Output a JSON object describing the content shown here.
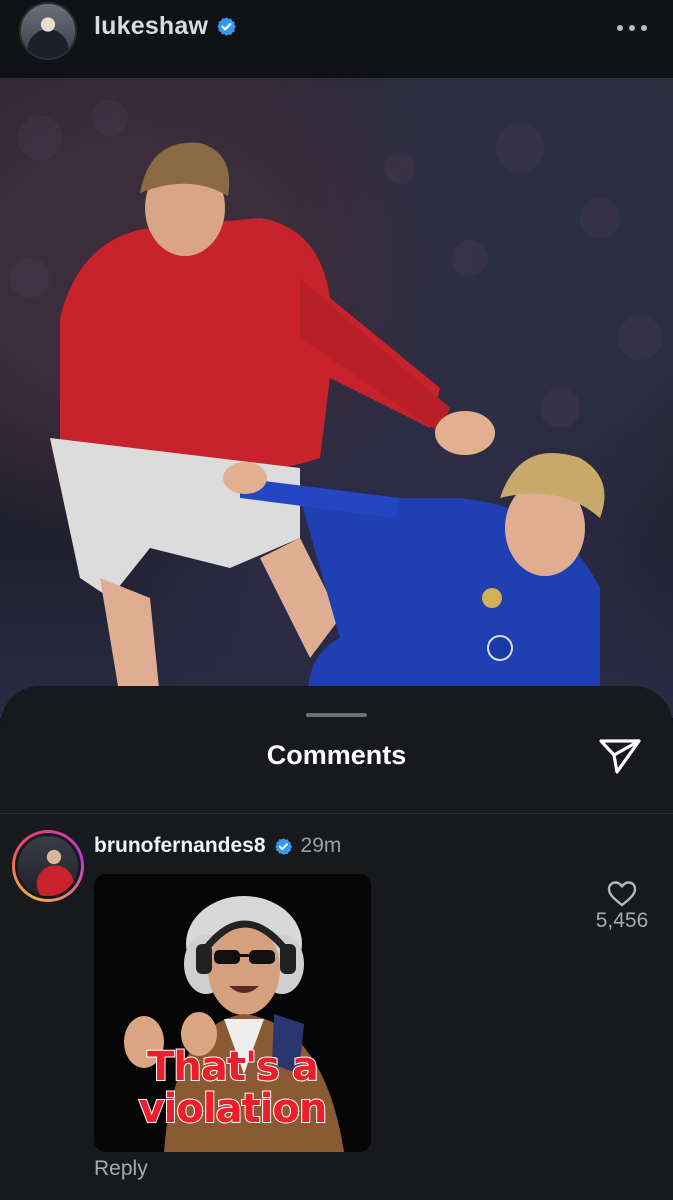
{
  "header": {
    "username": "lukeshaw",
    "verified_icon": "verified-badge-icon",
    "more_icon": "more-horizontal-icon"
  },
  "post": {
    "image_description_icon": "post-photo"
  },
  "comments_sheet": {
    "title": "Comments",
    "share_icon": "send-icon"
  },
  "comment": {
    "username": "brunofernandes8",
    "time": "29m",
    "gif_caption_line1": "That's a",
    "gif_caption_line2": "violation",
    "like_count": "5,456",
    "reply_label": "Reply"
  },
  "colors": {
    "background": "#0b0c0e",
    "sheet": "#17191d",
    "verified_blue": "#3897f0",
    "muted_text": "#a7aab1"
  }
}
